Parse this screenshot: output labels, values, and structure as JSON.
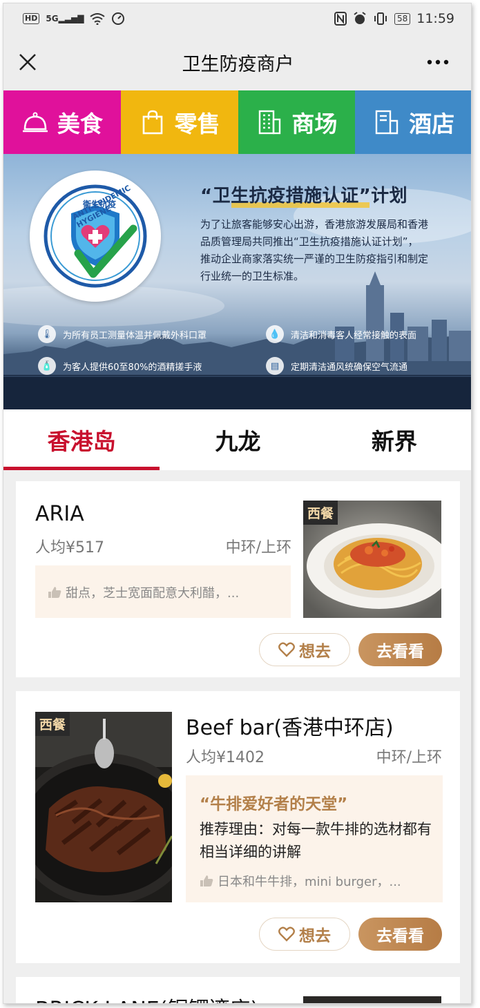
{
  "status_bar": {
    "left_icons": [
      "HD",
      "5G",
      "signal-icon",
      "wifi-icon",
      "speed-icon"
    ],
    "battery": "58",
    "time": "11:59"
  },
  "header": {
    "title": "卫生防疫商户"
  },
  "categories": [
    {
      "label": "美食",
      "icon": "cloche-icon",
      "color": "#e0119b"
    },
    {
      "label": "零售",
      "icon": "shopping-bag-icon",
      "color": "#f1b70f"
    },
    {
      "label": "商场",
      "icon": "building-icon",
      "color": "#2bb04a"
    },
    {
      "label": "酒店",
      "icon": "hotel-icon",
      "color": "#3f8ac8"
    }
  ],
  "banner": {
    "badge_en": "ANTI-EPIDEMIC HYGIENE",
    "badge_zh": "衛生抗疫",
    "title": "“卫生抗疫措施认证”计划",
    "description": "为了让旅客能够安心出游，香港旅游发展局和香港品质管理局共同推出“卫生抗疫措施认证计划”，推动企业商家落实统一严谨的卫生防疫指引和制定行业统一的卫生标准。",
    "features": [
      "为所有员工测量体温并佩戴外科口罩",
      "清洁和消毒客人经常接触的表面",
      "为客人提供60至80%的酒精搓手液",
      "定期清洁通风统确保空气流通"
    ]
  },
  "tabs": [
    {
      "label": "香港岛",
      "active": true
    },
    {
      "label": "九龙",
      "active": false
    },
    {
      "label": "新界",
      "active": false
    }
  ],
  "merchants": [
    {
      "name": "ARIA",
      "price": "人均¥517",
      "area": "中环/上环",
      "tags": "甜点，芝士宽面配意大利醋，...",
      "cuisine": "西餐",
      "want_label": "想去",
      "go_label": "去看看"
    },
    {
      "name": "Beef bar(香港中环店)",
      "price": "人均¥1402",
      "area": "中环/上环",
      "quote": "“牛排爱好者的天堂”",
      "reason": "推荐理由：对每一款牛排的选材都有相当详细的讲解",
      "tags": "日本和牛牛排，mini burger，...",
      "cuisine": "西餐",
      "want_label": "想去",
      "go_label": "去看看"
    },
    {
      "name": "BRICK LANE(铜锣湾店)"
    }
  ]
}
